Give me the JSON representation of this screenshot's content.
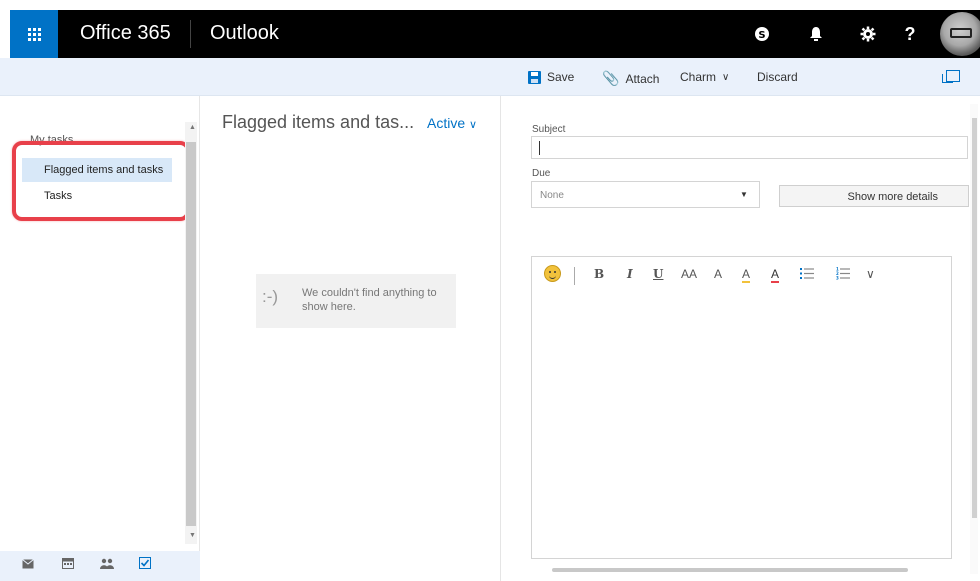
{
  "header": {
    "brand": "Office 365",
    "app_name": "Outlook",
    "icons": [
      "skype-icon",
      "bell-icon",
      "gear-icon",
      "help-icon"
    ]
  },
  "toolbar": {
    "save_label": "Save",
    "attach_label": "Attach",
    "charm_label": "Charm",
    "discard_label": "Discard"
  },
  "sidebar": {
    "section_header": "My tasks",
    "items": [
      {
        "label": "Flagged items and tasks",
        "selected": true
      },
      {
        "label": "Tasks",
        "selected": false
      }
    ]
  },
  "list": {
    "title": "Flagged items and tas...",
    "filter_label": "Active",
    "empty_face": ":-)",
    "empty_message": "We couldn't find anything to show here."
  },
  "form": {
    "subject_label": "Subject",
    "subject_value": "",
    "due_label": "Due",
    "due_value": "None",
    "show_more_label": "Show more details"
  },
  "editor_toolbar": [
    "B",
    "I",
    "U",
    "AA",
    "A",
    "A",
    "A",
    "list",
    "list",
    "more"
  ],
  "colors": {
    "brand_blue": "#0072c6",
    "topbar": "#000000",
    "command_bar": "#eaf1fb",
    "highlight": "#e8404a",
    "selected_item": "#d8e8f8"
  }
}
